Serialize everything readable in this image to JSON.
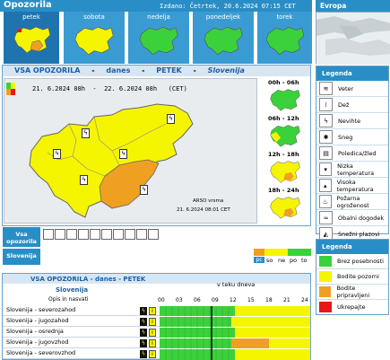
{
  "header": {
    "title": "Opozorila",
    "issued": "Izdano: Četrtek, 20.6.2024 07:15 CET",
    "region": "Evropa"
  },
  "days": [
    {
      "label": "petek",
      "active": true
    },
    {
      "label": "sobota",
      "active": false
    },
    {
      "label": "nedelja",
      "active": false
    },
    {
      "label": "ponedeljek",
      "active": false
    },
    {
      "label": "torek",
      "active": false
    }
  ],
  "map_panel": {
    "title_a": "VSA OPOZORILA",
    "sep1": "-",
    "title_b": "danes",
    "sep2": "-",
    "title_c": "PETEK",
    "sep3": "-",
    "title_d": "Slovenija",
    "period": "21. 6.2024 08h  -  22. 6.2024 08h   (CET)",
    "credit_line1": "ARSO vrsma",
    "credit_line2": "21. 6.2024 08:01 CET",
    "slots": [
      "00h - 06h",
      "06h - 12h",
      "12h - 18h",
      "18h - 24h"
    ]
  },
  "summary": {
    "row1_label": "Vsa opozorila",
    "row2_label": "Slovenija",
    "scale": [
      "pc",
      "so",
      "ne",
      "po",
      "to"
    ]
  },
  "legend_types": {
    "title": "Legenda",
    "items": [
      {
        "label": "Veter",
        "icon": "wind-icon",
        "glyph": "≋"
      },
      {
        "label": "Dež",
        "icon": "rain-icon",
        "glyph": "⁞"
      },
      {
        "label": "Nevihte",
        "icon": "thunderstorm-icon",
        "glyph": "ϟ"
      },
      {
        "label": "Sneg",
        "icon": "snow-icon",
        "glyph": "✱"
      },
      {
        "label": "Poledica/žled",
        "icon": "ice-icon",
        "glyph": "▤"
      },
      {
        "label": "Nizka temperatura",
        "icon": "low-temperature-icon",
        "glyph": "▾"
      },
      {
        "label": "Visoka temperatura",
        "icon": "high-temperature-icon",
        "glyph": "▴"
      },
      {
        "label": "Požarna ogroženost",
        "icon": "fire-icon",
        "glyph": "♨"
      },
      {
        "label": "Obalni dogodek",
        "icon": "coastal-icon",
        "glyph": "≈"
      },
      {
        "label": "Snežni plazovi",
        "icon": "avalanche-icon",
        "glyph": "◭"
      }
    ]
  },
  "legend_levels": {
    "title": "Legenda",
    "items": [
      {
        "label": "Brez posebnosti",
        "color": "#3bd13b"
      },
      {
        "label": "Bodite pozorni",
        "color": "#f5f500"
      },
      {
        "label": "Bodite pripravljeni",
        "color": "#f0a020"
      },
      {
        "label": "Ukrepajte",
        "color": "#e81818"
      }
    ]
  },
  "timeline": {
    "title": "VSA OPOZORILA - danes - PETEK",
    "subtitle": "Slovenija",
    "col_header_left": "Opis in nasvati",
    "col_header_mid": "v teku dneva",
    "hours": [
      "00",
      "03",
      "06",
      "09",
      "12",
      "15",
      "18",
      "21",
      "24"
    ],
    "rows": [
      {
        "label": "Slovenija - severozahod"
      },
      {
        "label": "Slovenija - jugozahod"
      },
      {
        "label": "Slovenija - osrednja"
      },
      {
        "label": "Slovenija - jugovzhod"
      },
      {
        "label": "Slovenija - severovzhod"
      }
    ]
  },
  "colors": {
    "header_blue": "#2a8ec6",
    "green": "#3bd13b",
    "yellow": "#f5f500",
    "orange": "#f0a020",
    "red": "#e81818"
  }
}
